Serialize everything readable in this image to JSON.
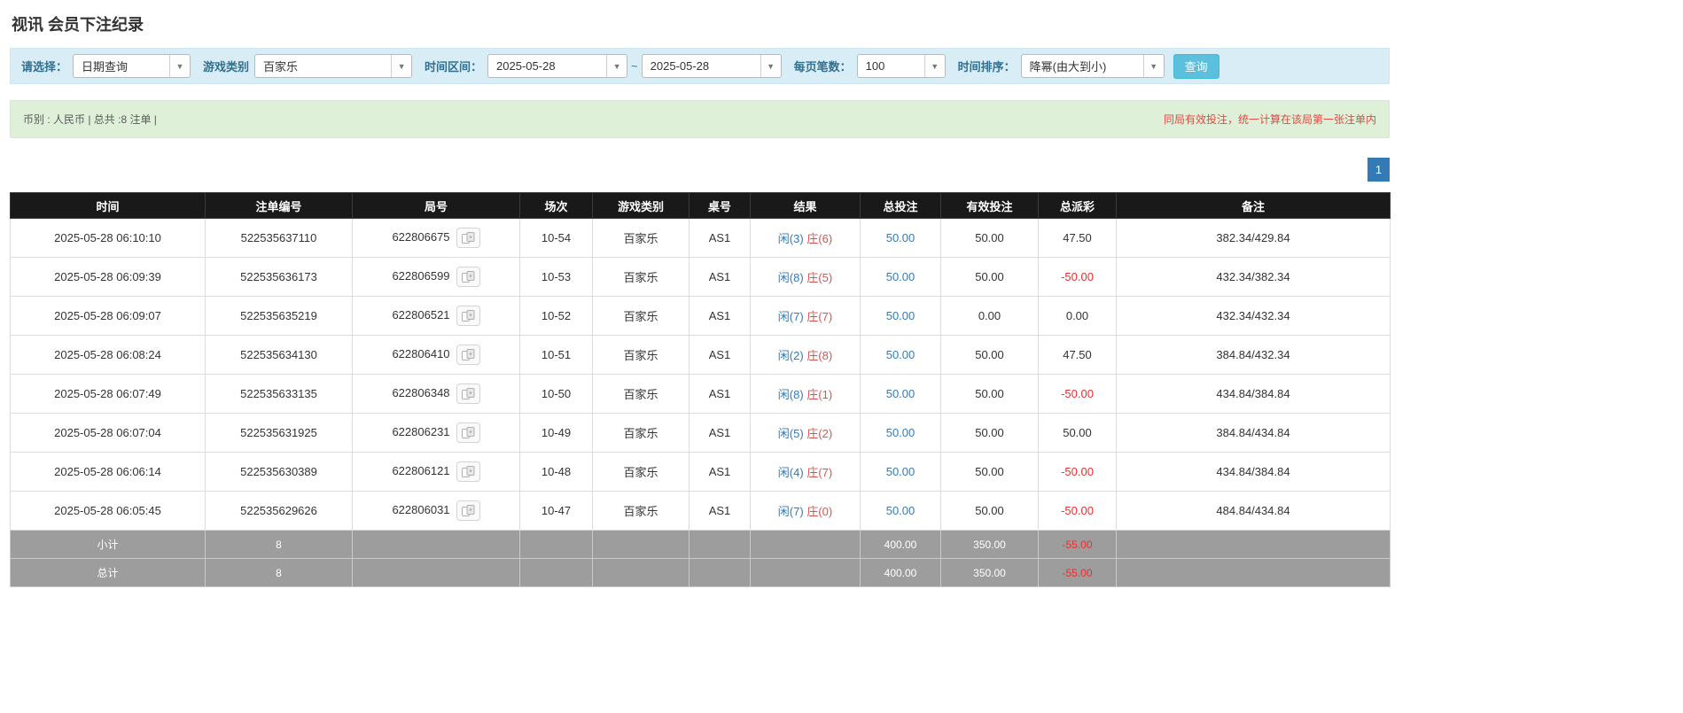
{
  "page": {
    "title": "视讯 会员下注纪录"
  },
  "filters": {
    "select_label": "请选择：",
    "select_value": "日期查询",
    "game_type_label": "游戏类别",
    "game_type_value": "百家乐",
    "time_range_label": "时间区间：",
    "time_from": "2025-05-28",
    "range_separator": "~",
    "time_to": "2025-05-28",
    "page_size_label": "每页笔数：",
    "page_size_value": "100",
    "sort_label": "时间排序：",
    "sort_value": "降幂(由大到小)",
    "search_button": "查询"
  },
  "summary": {
    "left": "币别 : 人民币 | 总共 :8 注单 |",
    "right": "同局有效投注，统一计算在该局第一张注单内"
  },
  "pagination": {
    "current": "1"
  },
  "table": {
    "headers": [
      "时间",
      "注单编号",
      "局号",
      "场次",
      "游戏类别",
      "桌号",
      "结果",
      "总投注",
      "有效投注",
      "总派彩",
      "备注"
    ],
    "rows": [
      {
        "time": "2025-05-28 06:10:10",
        "bet_id": "522535637110",
        "round_id": "622806675",
        "session": "10-54",
        "game": "百家乐",
        "table": "AS1",
        "player": "闲(3)",
        "banker": "庄(6)",
        "total_bet": "50.00",
        "valid_bet": "50.00",
        "payout": "47.50",
        "remark": "382.34/429.84"
      },
      {
        "time": "2025-05-28 06:09:39",
        "bet_id": "522535636173",
        "round_id": "622806599",
        "session": "10-53",
        "game": "百家乐",
        "table": "AS1",
        "player": "闲(8)",
        "banker": "庄(5)",
        "total_bet": "50.00",
        "valid_bet": "50.00",
        "payout": "-50.00",
        "remark": "432.34/382.34"
      },
      {
        "time": "2025-05-28 06:09:07",
        "bet_id": "522535635219",
        "round_id": "622806521",
        "session": "10-52",
        "game": "百家乐",
        "table": "AS1",
        "player": "闲(7)",
        "banker": "庄(7)",
        "total_bet": "50.00",
        "valid_bet": "0.00",
        "payout": "0.00",
        "remark": "432.34/432.34"
      },
      {
        "time": "2025-05-28 06:08:24",
        "bet_id": "522535634130",
        "round_id": "622806410",
        "session": "10-51",
        "game": "百家乐",
        "table": "AS1",
        "player": "闲(2)",
        "banker": "庄(8)",
        "total_bet": "50.00",
        "valid_bet": "50.00",
        "payout": "47.50",
        "remark": "384.84/432.34"
      },
      {
        "time": "2025-05-28 06:07:49",
        "bet_id": "522535633135",
        "round_id": "622806348",
        "session": "10-50",
        "game": "百家乐",
        "table": "AS1",
        "player": "闲(8)",
        "banker": "庄(1)",
        "total_bet": "50.00",
        "valid_bet": "50.00",
        "payout": "-50.00",
        "remark": "434.84/384.84"
      },
      {
        "time": "2025-05-28 06:07:04",
        "bet_id": "522535631925",
        "round_id": "622806231",
        "session": "10-49",
        "game": "百家乐",
        "table": "AS1",
        "player": "闲(5)",
        "banker": "庄(2)",
        "total_bet": "50.00",
        "valid_bet": "50.00",
        "payout": "50.00",
        "remark": "384.84/434.84"
      },
      {
        "time": "2025-05-28 06:06:14",
        "bet_id": "522535630389",
        "round_id": "622806121",
        "session": "10-48",
        "game": "百家乐",
        "table": "AS1",
        "player": "闲(4)",
        "banker": "庄(7)",
        "total_bet": "50.00",
        "valid_bet": "50.00",
        "payout": "-50.00",
        "remark": "434.84/384.84"
      },
      {
        "time": "2025-05-28 06:05:45",
        "bet_id": "522535629626",
        "round_id": "622806031",
        "session": "10-47",
        "game": "百家乐",
        "table": "AS1",
        "player": "闲(7)",
        "banker": "庄(0)",
        "total_bet": "50.00",
        "valid_bet": "50.00",
        "payout": "-50.00",
        "remark": "484.84/434.84"
      }
    ],
    "subtotal": {
      "label": "小计",
      "count": "8",
      "total_bet": "400.00",
      "valid_bet": "350.00",
      "payout": "-55.00"
    },
    "total": {
      "label": "总计",
      "count": "8",
      "total_bet": "400.00",
      "valid_bet": "350.00",
      "payout": "-55.00"
    }
  },
  "colors": {
    "player_blue": "#337ab7",
    "banker_red": "#d9534f",
    "negative_red": "#ef2d2d",
    "search_button": "#5bc0de",
    "header_bg": "#191919",
    "footer_bg": "#9d9d9d",
    "filter_bar_bg": "#d9edf7",
    "summary_bar_bg": "#dff0d8"
  }
}
